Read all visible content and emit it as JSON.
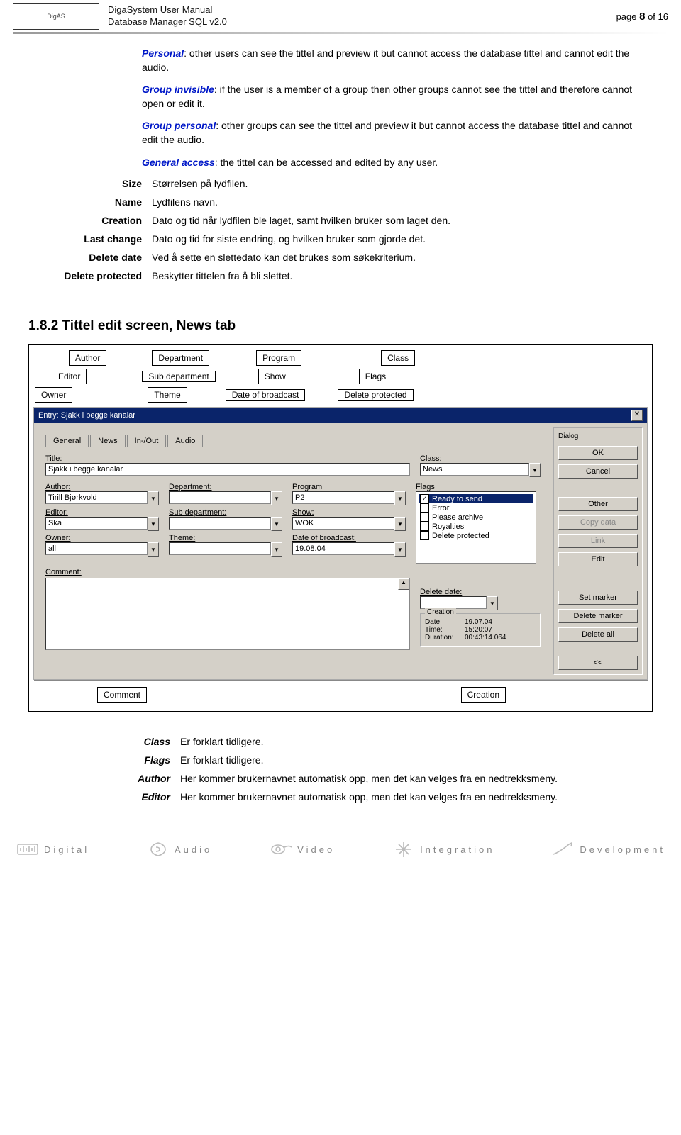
{
  "header": {
    "manual_line1": "DigaSystem User Manual",
    "manual_line2": "Database Manager SQL v2.0",
    "page_label": "page ",
    "page_num": "8",
    "page_of": " of 16"
  },
  "intro_paragraphs": {
    "p1_term": "Personal",
    "p1_rest": ": other users can see the tittel and preview it but cannot access the database tittel and cannot edit the audio.",
    "p2_term": "Group invisible",
    "p2_rest": ": if the user is a member of a group then other groups cannot see the tittel and therefore cannot open or edit it.",
    "p3_term": "Group personal",
    "p3_rest": ": other groups can see the tittel and preview it but cannot access the database tittel and cannot edit the audio.",
    "p4_term": "General access",
    "p4_rest": ": the tittel can be accessed and edited by any user."
  },
  "defs1": [
    {
      "term": "Size",
      "val": "Størrelsen på lydfilen."
    },
    {
      "term": "Name",
      "val": "Lydfilens navn."
    },
    {
      "term": "Creation",
      "val": "Dato og tid når lydfilen ble laget, samt hvilken bruker som laget den."
    },
    {
      "term": "Last change",
      "val": "Dato og tid for siste endring, og hvilken bruker som gjorde det."
    },
    {
      "term": "Delete date",
      "val": "Ved å sette en slettedato kan det brukes som søkekriterium."
    },
    {
      "term": "Delete protected",
      "val": "Beskytter tittelen fra å bli slettet."
    }
  ],
  "section_heading": "1.8.2  Tittel edit screen, News tab",
  "callouts_top": {
    "author": "Author",
    "editor": "Editor",
    "owner": "Owner",
    "department": "Department",
    "sub_department": "Sub department",
    "theme": "Theme",
    "program": "Program",
    "show": "Show",
    "date_of_broadcast": "Date of broadcast",
    "class": "Class",
    "flags": "Flags",
    "delete_protected": "Delete protected"
  },
  "window": {
    "title": "Entry: Sjakk i begge kanalar",
    "tabs": [
      "General",
      "News",
      "In-/Out",
      "Audio"
    ],
    "dialog_label": "Dialog",
    "buttons": {
      "ok": "OK",
      "cancel": "Cancel",
      "other": "Other",
      "copy_data": "Copy data",
      "link": "Link",
      "edit": "Edit",
      "set_marker": "Set marker",
      "delete_marker": "Delete marker",
      "delete_all": "Delete all",
      "back": "<<"
    },
    "fields": {
      "title_label": "Title:",
      "title_value": "Sjakk i begge kanalar",
      "author_label": "Author:",
      "author_value": "Tirill Bjørkvold",
      "editor_label": "Editor:",
      "editor_value": "Ska",
      "owner_label": "Owner:",
      "owner_value": "all",
      "department_label": "Department:",
      "department_value": "",
      "subdept_label": "Sub department:",
      "subdept_value": "",
      "theme_label": "Theme:",
      "theme_value": "",
      "program_label": "Program",
      "program_value": "P2",
      "show_label": "Show:",
      "show_value": "WOK",
      "dob_label": "Date of broadcast:",
      "dob_value": "19.08.04",
      "class_label": "Class:",
      "class_value": "News",
      "flags_label": "Flags",
      "comment_label": "Comment:",
      "delete_date_label": "Delete date:",
      "delete_date_value": ""
    },
    "flags_list": [
      {
        "label": "Ready to send",
        "checked": true,
        "selected": true
      },
      {
        "label": "Error",
        "checked": false,
        "selected": false
      },
      {
        "label": "Please archive",
        "checked": false,
        "selected": false
      },
      {
        "label": "Royalties",
        "checked": false,
        "selected": false
      },
      {
        "label": "Delete protected",
        "checked": false,
        "selected": false
      }
    ],
    "creation": {
      "group_label": "Creation",
      "date_label": "Date:",
      "date_value": "19.07.04",
      "time_label": "Time:",
      "time_value": "15:20:07",
      "duration_label": "Duration:",
      "duration_value": "00:43:14.064"
    }
  },
  "callouts_bottom": {
    "comment": "Comment",
    "creation": "Creation"
  },
  "defs2": [
    {
      "term": "Class",
      "val": "Er forklart tidligere."
    },
    {
      "term": "Flags",
      "val": "Er forklart tidligere."
    },
    {
      "term": "Author",
      "val": "Her kommer brukernavnet automatisk opp, men det kan velges fra en nedtrekksmeny."
    },
    {
      "term": "Editor",
      "val": "Her kommer brukernavnet automatisk opp, men det kan velges fra en nedtrekksmeny."
    }
  ],
  "footer": {
    "digital": "Digital",
    "audio": "Audio",
    "video": "Video",
    "integration": "Integration",
    "development": "Development"
  }
}
